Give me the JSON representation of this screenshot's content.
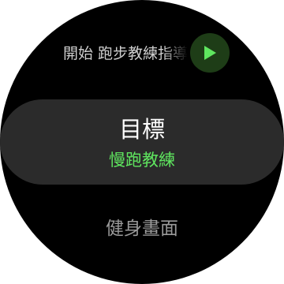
{
  "start": {
    "label": "開始 跑步教練指導",
    "icon": "play-icon",
    "icon_color": "#5fe65f",
    "button_bg": "#1e3d17"
  },
  "target_card": {
    "title": "目標",
    "value": "慢跑教練",
    "value_color": "#5fe65f"
  },
  "workout_screen": {
    "label": "健身畫面"
  }
}
